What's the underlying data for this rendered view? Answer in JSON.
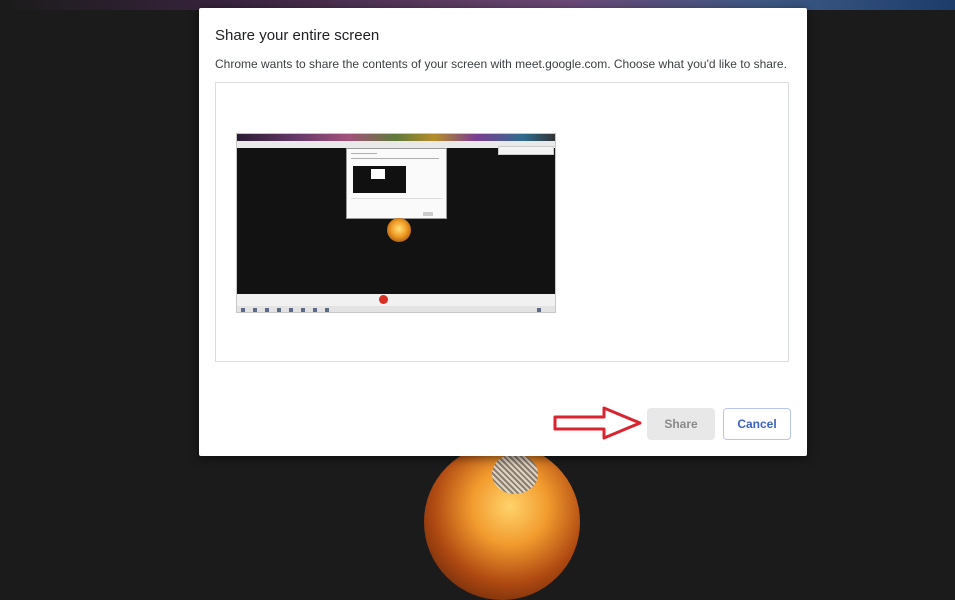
{
  "dialog": {
    "title": "Share your entire screen",
    "description": "Chrome wants to share the contents of your screen with meet.google.com. Choose what you'd like to share.",
    "share_label": "Share",
    "cancel_label": "Cancel",
    "share_enabled": false
  },
  "colors": {
    "cancel_text": "#3a62c4",
    "share_disabled_bg": "#e8e8e8",
    "annotation_arrow": "#d9232e",
    "record_dot": "#d93025"
  },
  "icons": [
    "screen-thumbnail",
    "red-arrow-annotation",
    "microphone-logo"
  ]
}
